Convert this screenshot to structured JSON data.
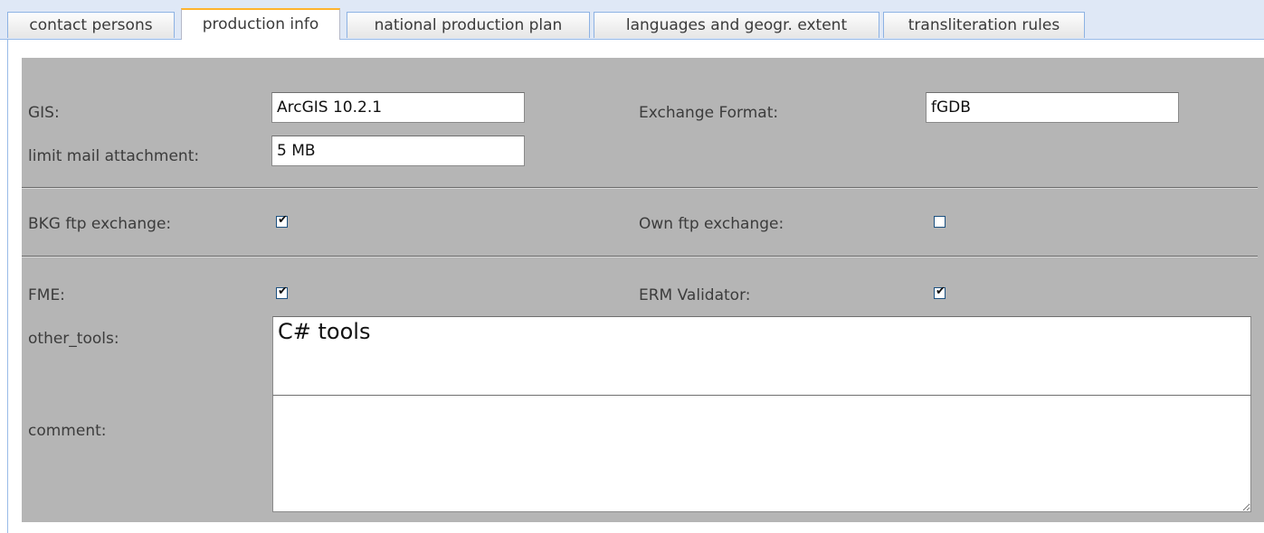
{
  "tabs": [
    {
      "label": "contact persons",
      "active": false
    },
    {
      "label": "production info",
      "active": true
    },
    {
      "label": "national production plan",
      "active": false
    },
    {
      "label": "languages and geogr. extent",
      "active": false
    },
    {
      "label": "transliteration rules",
      "active": false
    }
  ],
  "form": {
    "gis_label": "GIS:",
    "gis_value": "ArcGIS 10.2.1",
    "exchange_format_label": "Exchange Format:",
    "exchange_format_value": "fGDB",
    "limit_mail_label": "limit mail attachment:",
    "limit_mail_value": "5 MB",
    "bkg_ftp_label": "BKG ftp exchange:",
    "bkg_ftp_checked": true,
    "own_ftp_label": "Own ftp exchange:",
    "own_ftp_checked": false,
    "fme_label": "FME:",
    "fme_checked": true,
    "erm_label": "ERM Validator:",
    "erm_checked": true,
    "other_tools_label": "other_tools:",
    "other_tools_value": "C# tools",
    "comment_label": "comment:",
    "comment_value": ""
  },
  "colors": {
    "tab_strip": "#dfe8f6",
    "active_tab_accent": "#ffb42e",
    "panel_bg": "#b5b5b5"
  }
}
